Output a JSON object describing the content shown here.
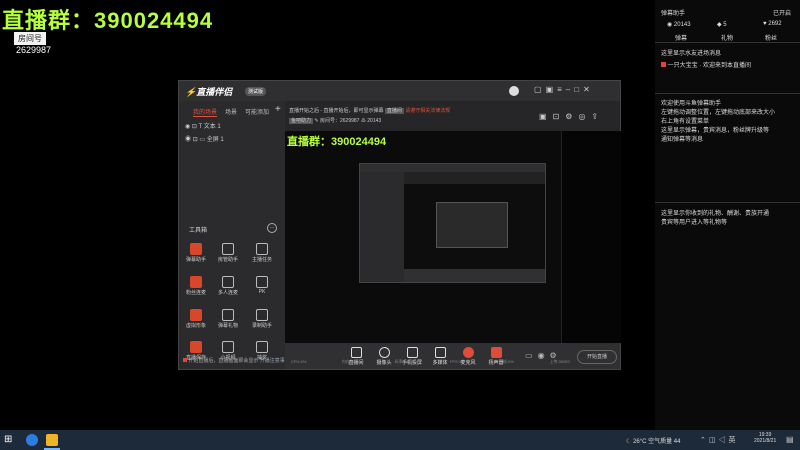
{
  "overlay": {
    "title": "直播群：390024494",
    "room_label": "房间号",
    "room_number": "2629987"
  },
  "right_panel": {
    "header_title": "弹幕助手",
    "header_status": "已开启",
    "stats": [
      "20143",
      "5",
      "2692"
    ],
    "tabs": [
      "弹幕",
      "礼物",
      "粉丝"
    ],
    "hint1": "这里显示水友进场消息",
    "welcome_line": "一只大宝宝 · 欢迎来到本直播间",
    "intro": [
      "欢迎使用斗鱼弹幕助手",
      "左键拖动调整位置，左键拖动底部来改大小",
      "右上角有设置菜单",
      "这里显示弹幕，贵宾消息，粉丝牌升级等",
      "通知弹幕等消息"
    ],
    "hint2": [
      "这里显示你收到的礼物、酬谢、贵族开通",
      "贵宾等用户进入等礼物等"
    ]
  },
  "app": {
    "logo": "直播伴侣",
    "version": "测试版",
    "tabs": [
      "我的场景",
      "场景",
      "可能添加"
    ],
    "add_label": "+",
    "scenes": [
      {
        "label": "文本 1"
      },
      {
        "label": "全屏 1"
      }
    ],
    "tools_title": "工具箱",
    "tools": [
      "弹幕助手",
      "房管助手",
      "主播任务",
      "粉丝连麦",
      "多人连麦",
      "PK",
      "虚拟形象",
      "弹幕礼物",
      "录制助手",
      "直播保存",
      "小视频",
      "抽奖"
    ],
    "notice": "开始直播后，直播画面即会显示",
    "notice_link": "开播注意事项",
    "live_notice": "直播开始之后 - 直播开始后，即可显示弹幕",
    "live_tag": "直播间",
    "live_warning": "请遵守相关法律法规",
    "room_tag": "鱼吧助力",
    "room_id_label": "房间号：2629987",
    "room_fans": "20143",
    "preview_title": "直播群：390024494",
    "bottom_buttons": [
      "直播间",
      "摄像头",
      "手机投屏",
      "多媒体",
      "麦克风",
      "扬声器"
    ],
    "start_button": "开始直播",
    "status_bar": [
      "CPU:4%",
      "内存:20%",
      "码率:0kbps",
      "FPS:30",
      "丢帧:0%",
      "上传:0KB/S"
    ]
  },
  "taskbar": {
    "weather": "26°C 空气质量 44",
    "time": "19:39",
    "date": "2021/8/21"
  }
}
